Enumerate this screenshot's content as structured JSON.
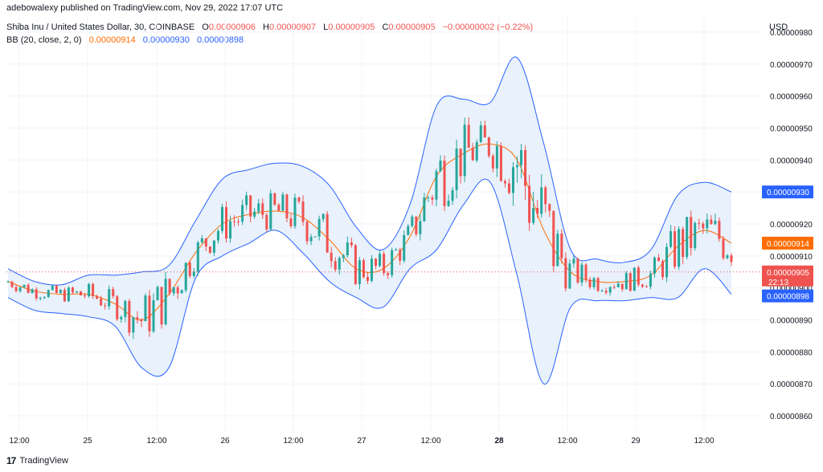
{
  "header": {
    "publisher_line": "adebowalexy published on TradingView.com, Nov 29, 2022 17:07 UTC"
  },
  "symbol": {
    "title": "Shiba Inu / United States Dollar, 30, COINBASE",
    "o_label": "O",
    "o_value": "0.00000906",
    "h_label": "H",
    "h_value": "0.00000907",
    "l_label": "L",
    "l_value": "0.00000905",
    "c_label": "C",
    "c_value": "0.00000905",
    "change": "−0.00000002 (−0.22%)"
  },
  "indicator": {
    "name": "BB (20, close, 2, 0)",
    "basis": "0.00000914",
    "upper": "0.00000930",
    "lower": "0.00000898"
  },
  "currency": "USD",
  "price_tags": {
    "upper": {
      "text": "0.00000930",
      "color": "#2962ff"
    },
    "basis": {
      "text": "0.00000914",
      "color": "#ff6d00"
    },
    "last": {
      "text": "0.00000905",
      "countdown": "22:13",
      "color": "#ef5350"
    },
    "lower": {
      "text": "0.00000898",
      "color": "#2962ff"
    }
  },
  "footer": {
    "brand": "TradingView",
    "logo": "17"
  },
  "colors": {
    "up": "#26a69a",
    "down": "#ef5350",
    "band_line": "#2962ff",
    "band_fill": "#e8f1fc",
    "basis": "#ff6d00",
    "grid": "#f0f3fa"
  },
  "chart_data": {
    "type": "candlestick",
    "title": "Shiba Inu / United States Dollar, 30, COINBASE",
    "y_axis": {
      "ticks": [
        "0.00000860",
        "0.00000870",
        "0.00000880",
        "0.00000890",
        "0.00000900",
        "0.00000910",
        "0.00000920",
        "0.00000930",
        "0.00000940",
        "0.00000950",
        "0.00000960",
        "0.00000970",
        "0.00000980"
      ],
      "unit": "USD",
      "range": [
        8.55e-06,
        9.85e-06
      ]
    },
    "x_axis": {
      "labels": [
        "12:00",
        "25",
        "12:00",
        "26",
        "12:00",
        "27",
        "12:00",
        "28",
        "12:00",
        "29",
        "12:00"
      ]
    },
    "series": [
      {
        "name": "Upper band",
        "values": [
          9.06e-06,
          9.02e-06,
          9.01e-06,
          9.04e-06,
          9.04e-06,
          9.05e-06,
          9.07e-06,
          9.21e-06,
          9.34e-06,
          9.37e-06,
          9.39e-06,
          9.38e-06,
          9.32e-06,
          9.19e-06,
          9.12e-06,
          9.26e-06,
          9.57e-06,
          9.59e-06,
          9.58e-06,
          9.72e-06,
          9.45e-06,
          9.12e-06,
          9.09e-06,
          9.08e-06,
          9.12e-06,
          9.29e-06,
          9.33e-06,
          9.3e-06
        ]
      },
      {
        "name": "Basis",
        "values": [
          9.02e-06,
          8.99e-06,
          8.98e-06,
          8.98e-06,
          8.95e-06,
          8.9e-06,
          8.98e-06,
          9.11e-06,
          9.2e-06,
          9.23e-06,
          9.24e-06,
          9.22e-06,
          9.15e-06,
          9.06e-06,
          9.06e-06,
          9.16e-06,
          9.35e-06,
          9.42e-06,
          9.45e-06,
          9.4e-06,
          9.18e-06,
          9.05e-06,
          9.02e-06,
          9.02e-06,
          9.04e-06,
          9.13e-06,
          9.18e-06,
          9.14e-06
        ]
      },
      {
        "name": "Lower band",
        "values": [
          8.97e-06,
          8.93e-06,
          8.92e-06,
          8.91e-06,
          8.88e-06,
          8.75e-06,
          8.75e-06,
          9.03e-06,
          9.1e-06,
          9.14e-06,
          9.18e-06,
          9.11e-06,
          9.02e-06,
          8.97e-06,
          8.94e-06,
          9.06e-06,
          9.12e-06,
          9.26e-06,
          9.33e-06,
          9.04e-06,
          8.7e-06,
          8.94e-06,
          8.96e-06,
          8.96e-06,
          8.97e-06,
          8.97e-06,
          9.06e-06,
          8.98e-06
        ]
      }
    ],
    "band_x": [
      "",
      "",
      "",
      "",
      "",
      "",
      "",
      "",
      "",
      "",
      "",
      "",
      "",
      "",
      "",
      "",
      "",
      "",
      "",
      "",
      "",
      "",
      "",
      "",
      "",
      "",
      "",
      ""
    ]
  }
}
